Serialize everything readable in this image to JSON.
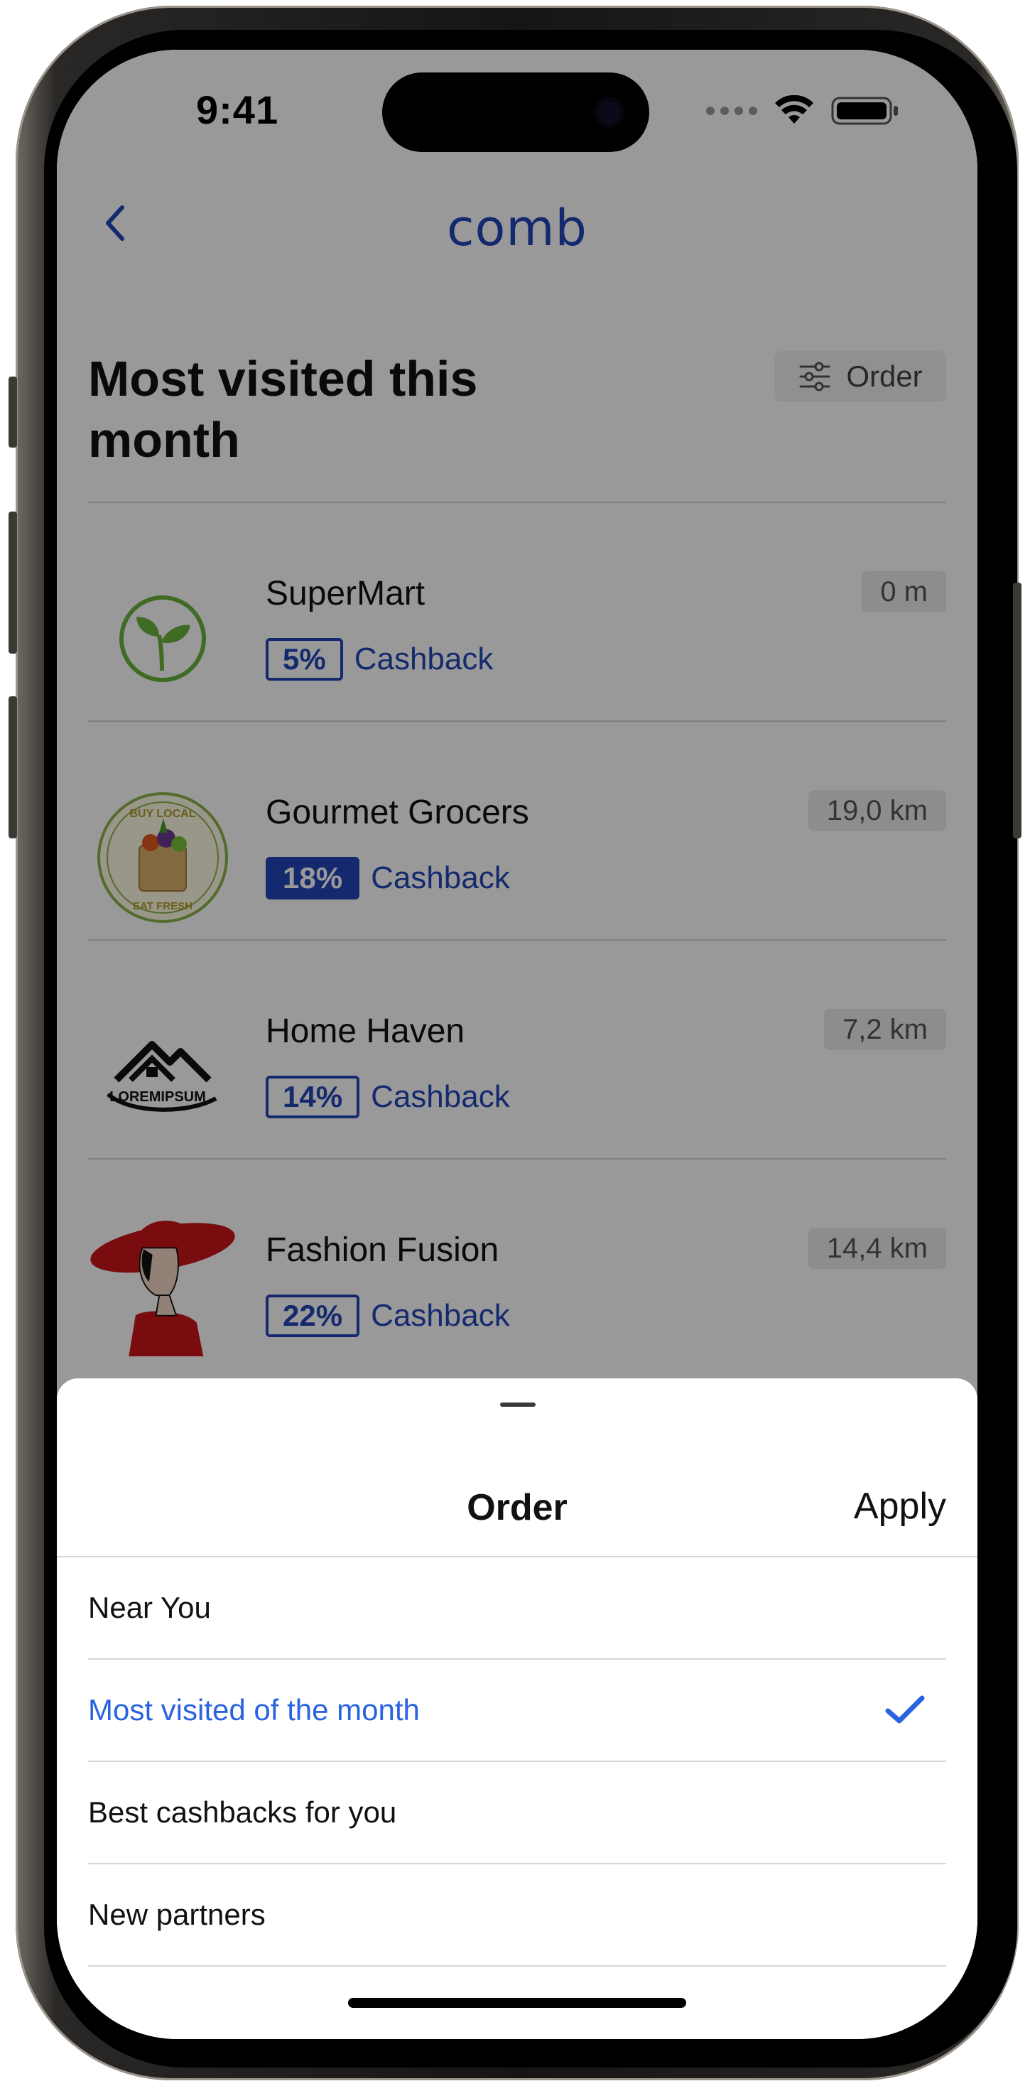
{
  "status_bar": {
    "time": "9:41"
  },
  "nav": {
    "brand": "comb"
  },
  "section": {
    "title": "Most visited this month",
    "order_label": "Order"
  },
  "stores": [
    {
      "name": "SuperMart",
      "distance": "0 m",
      "cashback": "5%",
      "cashback_label": "Cashback",
      "logo": "leaf-logo"
    },
    {
      "name": "Gourmet Grocers",
      "distance": "19,0 km",
      "cashback": "18%",
      "cashback_label": "Cashback",
      "logo": "buy-local-logo"
    },
    {
      "name": "Home Haven",
      "distance": "7,2 km",
      "cashback": "14%",
      "cashback_label": "Cashback",
      "logo": "house-logo"
    },
    {
      "name": "Fashion Fusion",
      "distance": "14,4 km",
      "cashback": "22%",
      "cashback_label": "Cashback",
      "logo": "woman-hat-logo"
    }
  ],
  "store_logo_text": {
    "buy_local_top": "BUY LOCAL",
    "buy_local_bottom": "EAT FRESH",
    "house_brand": "LOREMIPSUM"
  },
  "sheet": {
    "title": "Order",
    "apply": "Apply",
    "options": [
      {
        "label": "Near You",
        "selected": false
      },
      {
        "label": "Most visited of the month",
        "selected": true
      },
      {
        "label": "Best cashbacks for you",
        "selected": false
      },
      {
        "label": "New partners",
        "selected": false
      }
    ]
  },
  "colors": {
    "brand": "#2447b8",
    "selected": "#2a63e0",
    "overlay": "rgba(0,0,0,0.40)"
  }
}
